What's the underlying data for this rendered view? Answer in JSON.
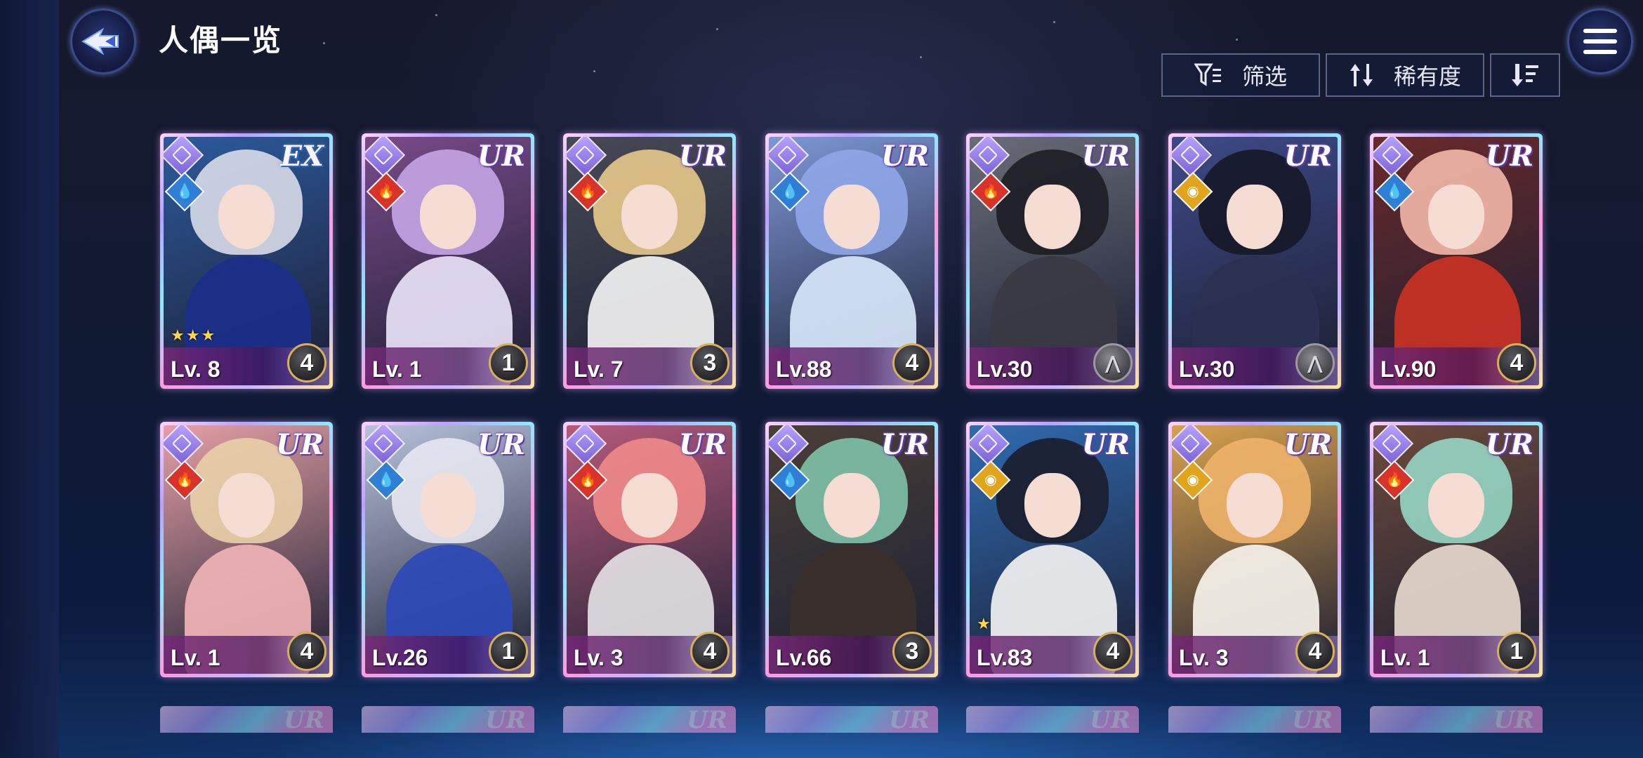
{
  "header": {
    "title": "人偶一览",
    "back_icon": "back-arrow-icon",
    "menu_icon": "hamburger-menu-icon"
  },
  "toolbar": {
    "filter_label": "筛选",
    "sort_label": "稀有度",
    "order_icon": "sort-descending-icon"
  },
  "elements": {
    "water": {
      "glyph": "💧",
      "color": "#2f7fd6"
    },
    "fire": {
      "glyph": "🔥",
      "color": "#d8332a"
    },
    "light": {
      "glyph": "◉",
      "color": "#e0a51c"
    }
  },
  "cards": [
    {
      "rarity": "EX",
      "level": "Lv. 8",
      "badge": "4",
      "element": "water",
      "stars": "★★★",
      "hair": "#d8dbe8",
      "body": "#1b2f8a",
      "bg": "#2c5a9c"
    },
    {
      "rarity": "UR",
      "level": "Lv. 1",
      "badge": "1",
      "element": "fire",
      "stars": "",
      "hair": "#c6a5e6",
      "body": "#e9e2f6",
      "bg": "#7a4a88"
    },
    {
      "rarity": "UR",
      "level": "Lv. 7",
      "badge": "3",
      "element": "fire",
      "stars": "",
      "hair": "#e8c98a",
      "body": "#f2f2f2",
      "bg": "#474a55"
    },
    {
      "rarity": "UR",
      "level": "Lv.88",
      "badge": "4",
      "element": "water",
      "stars": "",
      "hair": "#8fa6e8",
      "body": "#d8e6fa",
      "bg": "#7d98d6"
    },
    {
      "rarity": "UR",
      "level": "Lv.30",
      "badge": "wings",
      "element": "fire",
      "stars": "",
      "hair": "#1d1d24",
      "body": "#3a3a44",
      "bg": "#6a6d78"
    },
    {
      "rarity": "UR",
      "level": "Lv.30",
      "badge": "wings",
      "element": "light",
      "stars": "",
      "hair": "#151827",
      "body": "#2a3152",
      "bg": "#3d4a86"
    },
    {
      "rarity": "UR",
      "level": "Lv.90",
      "badge": "4",
      "element": "water",
      "stars": "",
      "hair": "#f3b8a9",
      "body": "#c93224",
      "bg": "#6a2a2a"
    },
    {
      "rarity": "UR",
      "level": "Lv. 1",
      "badge": "4",
      "element": "fire",
      "stars": "",
      "hair": "#e9d0a8",
      "body": "#f0b3b6",
      "bg": "#e5a0a6"
    },
    {
      "rarity": "UR",
      "level": "Lv.26",
      "badge": "1",
      "element": "water",
      "stars": "",
      "hair": "#e6e8f2",
      "body": "#2c49b8",
      "bg": "#b8c2dc"
    },
    {
      "rarity": "UR",
      "level": "Lv. 3",
      "badge": "4",
      "element": "fire",
      "stars": "",
      "hair": "#f08a8a",
      "body": "#e2e0e4",
      "bg": "#b65a7a"
    },
    {
      "rarity": "UR",
      "level": "Lv.66",
      "badge": "3",
      "element": "water",
      "stars": "",
      "hair": "#7fc2a8",
      "body": "#3a2f2a",
      "bg": "#4a3f38"
    },
    {
      "rarity": "UR",
      "level": "Lv.83",
      "badge": "4",
      "element": "light",
      "stars": "★",
      "hair": "#1a1d2c",
      "body": "#f2f2f2",
      "bg": "#2f6bb0"
    },
    {
      "rarity": "UR",
      "level": "Lv. 3",
      "badge": "4",
      "element": "light",
      "stars": "",
      "hair": "#f0b36a",
      "body": "#f6f3ea",
      "bg": "#d8a24e"
    },
    {
      "rarity": "UR",
      "level": "Lv. 1",
      "badge": "1",
      "element": "fire",
      "stars": "",
      "hair": "#96d6c4",
      "body": "#e6d8cc",
      "bg": "#6b4a3a"
    }
  ],
  "peek_row": [
    "UR",
    "UR",
    "UR",
    "UR",
    "UR",
    "UR",
    "UR"
  ]
}
